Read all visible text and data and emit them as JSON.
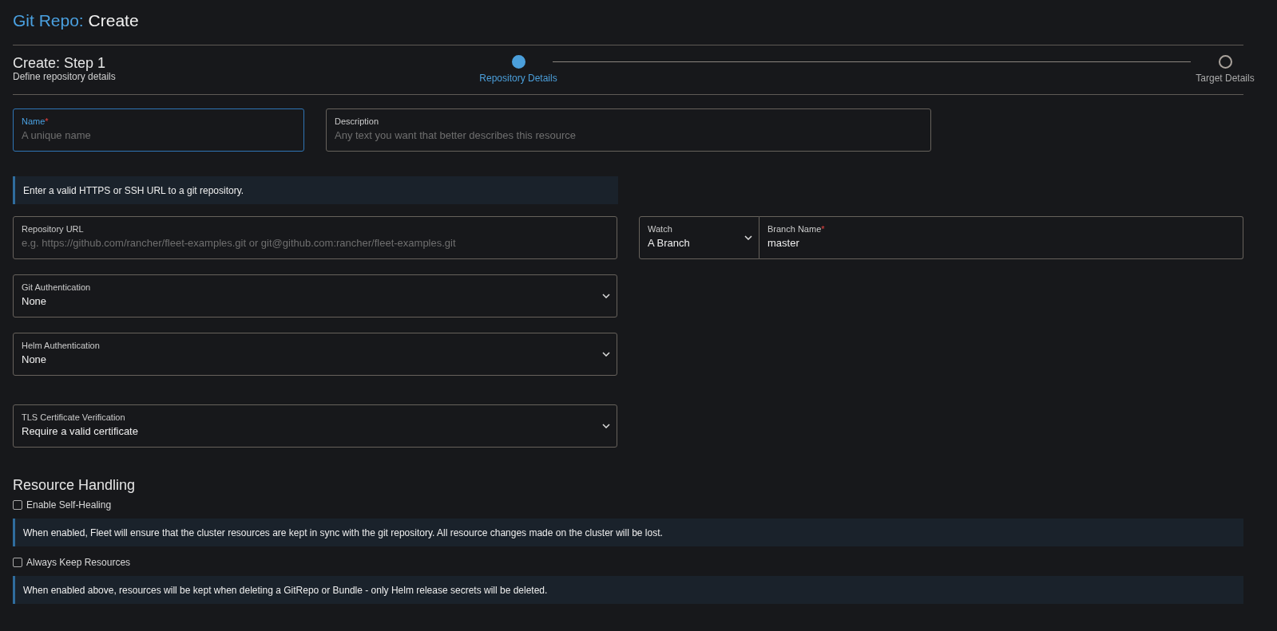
{
  "header": {
    "resource": "Git Repo:",
    "action": "Create"
  },
  "step": {
    "title": "Create: Step 1",
    "subtitle": "Define repository details"
  },
  "steps": [
    {
      "label": "Repository Details",
      "selected": true
    },
    {
      "label": "Target Details",
      "selected": false
    }
  ],
  "name": {
    "label": "Name",
    "required_mark": "*",
    "placeholder": "A unique name",
    "focused": true
  },
  "description": {
    "label": "Description",
    "placeholder": "Any text you want that better describes this resource",
    "focused": false
  },
  "url_info": "Enter a valid HTTPS or SSH URL to a git repository.",
  "repository_url": {
    "label": "Repository URL",
    "placeholder": "e.g. https://github.com/rancher/fleet-examples.git or git@github.com:rancher/fleet-examples.git",
    "focused": false
  },
  "watch": {
    "label": "Watch",
    "value": "A Branch"
  },
  "branch_name": {
    "label": "Branch Name",
    "required_mark": "*",
    "value": "master",
    "focused": false
  },
  "git_authentication": {
    "label": "Git Authentication",
    "value": "None"
  },
  "helm_authentication": {
    "label": "Helm Authentication",
    "value": "None"
  },
  "tls_verification": {
    "label": "TLS Certificate Verification",
    "value": "Require a valid certificate"
  },
  "resource_handling": {
    "title": "Resource Handling",
    "options": [
      {
        "label": "Enable Self-Healing",
        "checked": false,
        "info": "When enabled, Fleet will ensure that the cluster resources are kept in sync with the git repository. All resource changes made on the cluster will be lost."
      },
      {
        "label": "Always Keep Resources",
        "checked": false,
        "info": "When enabled above, resources will be kept when deleting a GitRepo or Bundle - only Helm release secrets will be deleted."
      }
    ]
  }
}
